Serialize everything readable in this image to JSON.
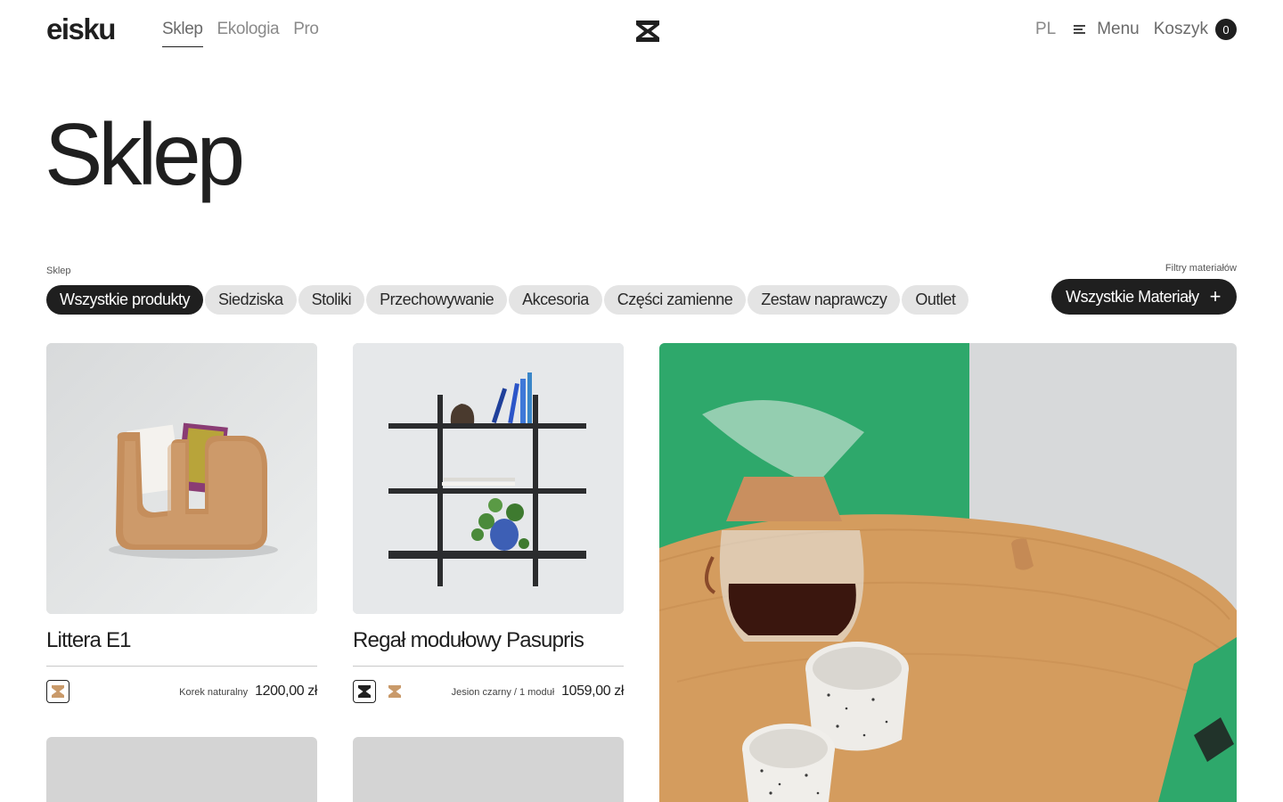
{
  "brand": {
    "logo": "eisku"
  },
  "topnav": [
    {
      "label": "Sklep",
      "active": true
    },
    {
      "label": "Ekologia",
      "active": false
    },
    {
      "label": "Pro",
      "active": false
    }
  ],
  "header_right": {
    "lang": "PL",
    "menu": "Menu",
    "cart": "Koszyk",
    "cart_count": "0"
  },
  "page": {
    "title": "Sklep",
    "breadcrumb": "Sklep"
  },
  "categories": [
    {
      "label": "Wszystkie produkty",
      "active": true
    },
    {
      "label": "Siedziska",
      "active": false
    },
    {
      "label": "Stoliki",
      "active": false
    },
    {
      "label": "Przechowywanie",
      "active": false
    },
    {
      "label": "Akcesoria",
      "active": false
    },
    {
      "label": "Części zamienne",
      "active": false
    },
    {
      "label": "Zestaw naprawczy",
      "active": false
    },
    {
      "label": "Outlet",
      "active": false
    }
  ],
  "materials": {
    "label": "Filtry materiałów",
    "button": "Wszystkie Materiały",
    "button_icon": "plus-icon"
  },
  "products": [
    {
      "name": "Littera E1",
      "variant": "Korek naturalny",
      "price": "1200,00 zł",
      "swatches": [
        "cork"
      ]
    },
    {
      "name": "Regał modułowy Pasupris",
      "variant": "Jesion czarny / 1 moduł",
      "price": "1059,00 zł",
      "swatches": [
        "black-ash",
        "cork"
      ]
    }
  ],
  "colors": {
    "ink": "#1f1f1f",
    "chip": "#e4e4e4",
    "cork": "#c99a6a",
    "green": "#2ea86b"
  }
}
